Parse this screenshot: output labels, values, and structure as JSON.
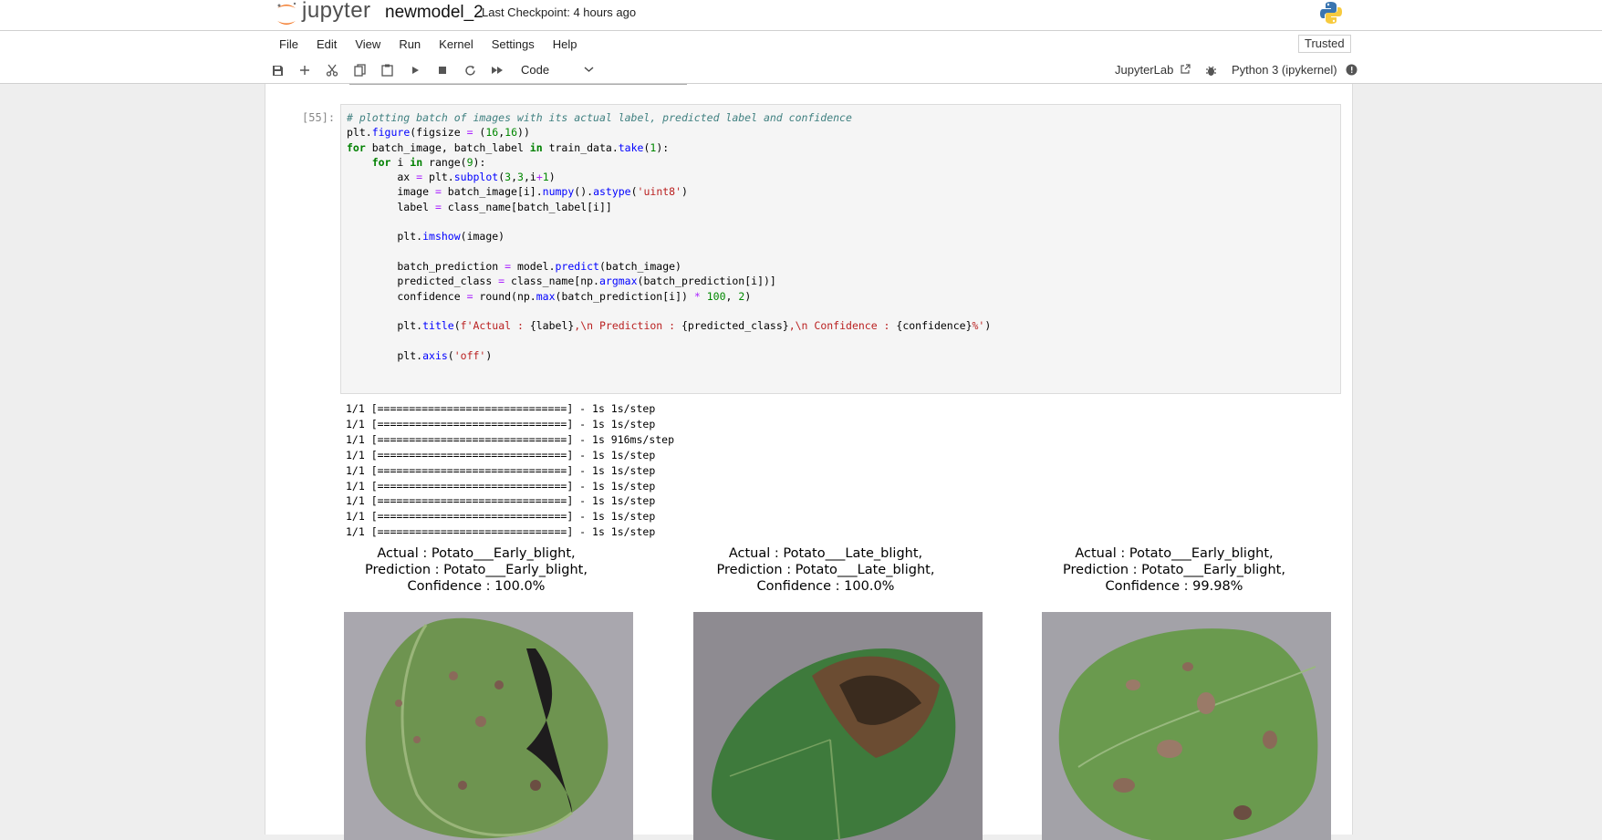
{
  "header": {
    "logo_text": "jupyter",
    "notebook_name": "newmodel_2",
    "checkpoint": "Last Checkpoint: 4 hours ago"
  },
  "menu": [
    "File",
    "Edit",
    "View",
    "Run",
    "Kernel",
    "Settings",
    "Help"
  ],
  "trusted": "Trusted",
  "toolbar": {
    "cell_type": "Code",
    "jupyterlab": "JupyterLab",
    "kernel": "Python 3 (ipykernel)"
  },
  "cell": {
    "prompt": "[55]:"
  },
  "output_lines": [
    "1/1 [==============================] - 1s 1s/step",
    "1/1 [==============================] - 1s 1s/step",
    "1/1 [==============================] - 1s 916ms/step",
    "1/1 [==============================] - 1s 1s/step",
    "1/1 [==============================] - 1s 1s/step",
    "1/1 [==============================] - 1s 1s/step",
    "1/1 [==============================] - 1s 1s/step",
    "1/1 [==============================] - 1s 1s/step",
    "1/1 [==============================] - 1s 1s/step"
  ],
  "plots": [
    {
      "title_line1": "Actual : Potato___Early_blight,",
      "title_line2": "Prediction : Potato___Early_blight,",
      "title_line3": "Confidence : 100.0%"
    },
    {
      "title_line1": "Actual : Potato___Late_blight,",
      "title_line2": "Prediction : Potato___Late_blight,",
      "title_line3": "Confidence : 100.0%"
    },
    {
      "title_line1": "Actual : Potato___Early_blight,",
      "title_line2": "Prediction : Potato___Early_blight,",
      "title_line3": "Confidence : 99.98%"
    }
  ],
  "colors": {
    "accent": "#f37726",
    "code_bg": "#f5f5f5",
    "page_bg": "#eeeeee"
  }
}
